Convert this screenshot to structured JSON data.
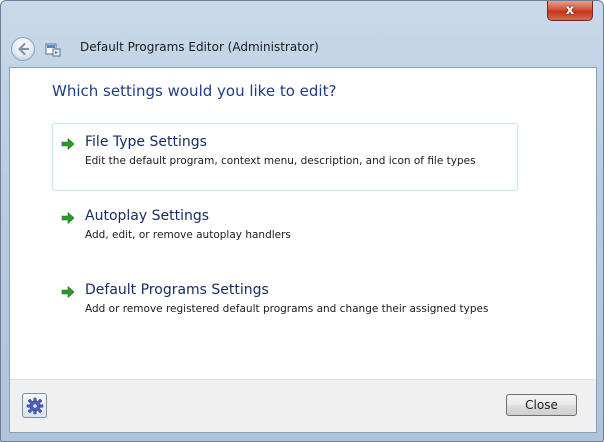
{
  "window": {
    "title": "Default Programs Editor (Administrator)",
    "close_glyph": "x"
  },
  "heading": "Which settings would you like to edit?",
  "options": [
    {
      "title": "File Type Settings",
      "description": "Edit the default program, context menu, description, and icon of file types",
      "icon": "green-arrow-icon"
    },
    {
      "title": "Autoplay Settings",
      "description": "Add, edit, or remove autoplay handlers",
      "icon": "green-arrow-icon"
    },
    {
      "title": "Default Programs Settings",
      "description": "Add or remove registered default programs and change their assigned types",
      "icon": "green-arrow-icon"
    }
  ],
  "footer": {
    "settings_icon": "gear-icon",
    "close_label": "Close"
  },
  "colors": {
    "heading": "#1e3d87",
    "arrow": "#2a9a2a",
    "close_button_red": "#c2361c"
  }
}
